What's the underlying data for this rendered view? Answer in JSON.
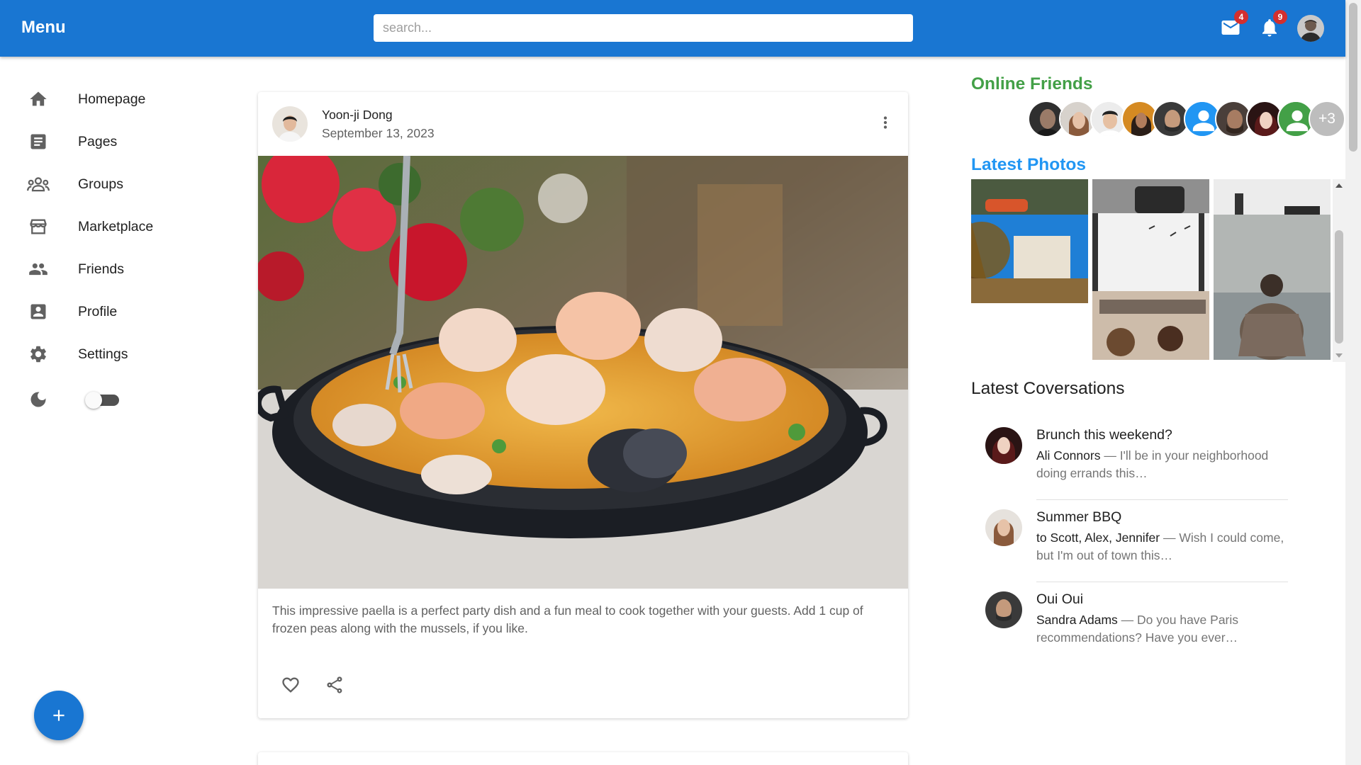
{
  "appbar": {
    "brand": "Menu",
    "search_placeholder": "search...",
    "mail_count": "4",
    "notification_count": "9",
    "accent_color": "#1976d2"
  },
  "sidebar": {
    "items": [
      {
        "label": "Homepage",
        "icon": "home-icon"
      },
      {
        "label": "Pages",
        "icon": "article-icon"
      },
      {
        "label": "Groups",
        "icon": "groups-icon"
      },
      {
        "label": "Marketplace",
        "icon": "storefront-icon"
      },
      {
        "label": "Friends",
        "icon": "people-icon"
      },
      {
        "label": "Profile",
        "icon": "account-box-icon"
      },
      {
        "label": "Settings",
        "icon": "gear-icon"
      }
    ],
    "dark_mode_icon": "moon-icon",
    "dark_mode_on": false,
    "fab_icon": "plus-icon"
  },
  "post": {
    "author": "Yoon-ji Dong",
    "date": "September 13, 2023",
    "caption": "This impressive paella is a perfect party dish and a fun meal to cook together with your guests. Add 1 cup of frozen peas along with the mussels, if you like.",
    "like_icon": "heart-outline-icon",
    "share_icon": "share-icon",
    "more_icon": "more-vert-icon"
  },
  "right": {
    "online_title": "Online Friends",
    "online_title_color": "#43a047",
    "online_more": "+3",
    "photos_title": "Latest Photos",
    "photos_title_color": "#2196f3",
    "conversations_title": "Latest Coversations",
    "conversations": [
      {
        "title": "Brunch this weekend?",
        "who": "Ali Connors",
        "snippet": " — I'll be in your neighborhood doing errands this…"
      },
      {
        "title": "Summer BBQ",
        "who": "to Scott, Alex, Jennifer",
        "snippet": " — Wish I could come, but I'm out of town this…"
      },
      {
        "title": "Oui Oui",
        "who": "Sandra Adams",
        "snippet": " — Do you have Paris recommendations? Have you ever…"
      }
    ]
  }
}
